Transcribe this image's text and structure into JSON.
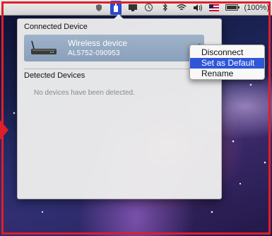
{
  "menubar": {
    "battery_percent": "(100%)",
    "battery_level": 1.0,
    "icons": [
      "shield-icon",
      "wireless-device-icon",
      "display-icon",
      "time-machine-icon",
      "bluetooth-icon",
      "wifi-icon",
      "volume-icon",
      "flag-icon",
      "battery-icon"
    ]
  },
  "panel": {
    "connected_title": "Connected Device",
    "detected_title": "Detected Devices",
    "empty_message": "No devices have been detected.",
    "device": {
      "name": "Wireless device",
      "id": "AL5752-090953"
    }
  },
  "context_menu": {
    "items": [
      {
        "label": "Disconnect",
        "highlighted": false
      },
      {
        "label": "Set as Default",
        "highlighted": true
      },
      {
        "label": "Rename",
        "highlighted": false
      }
    ]
  },
  "colors": {
    "accent": "#2f56d8",
    "highlight_frame": "#e01e2a",
    "signal": "#4fc23c"
  }
}
